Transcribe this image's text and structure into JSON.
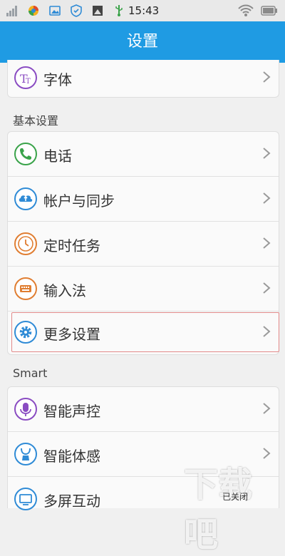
{
  "status_bar": {
    "time": "15:43",
    "left_icons": [
      "signal-icon",
      "app-icon",
      "image-icon",
      "shield-icon",
      "photo-icon",
      "usb-icon"
    ],
    "right_icons": [
      "wifi-icon",
      "battery-icon"
    ]
  },
  "header": {
    "title": "设置"
  },
  "items": {
    "font": "字体",
    "phone": "电话",
    "account_sync": "帐户与同步",
    "scheduled_tasks": "定时任务",
    "input_method": "输入法",
    "more_settings": "更多设置",
    "voice_control": "智能声控",
    "smart_motion": "智能体感",
    "multi_screen": "多屏互动"
  },
  "sections": {
    "basic": "基本设置",
    "smart": "Smart"
  },
  "watermark": {
    "logo_text": "下载吧",
    "sub_text": "已关闭"
  },
  "colors": {
    "header": "#1f9be3",
    "icon_green": "#3aa34a",
    "icon_blue": "#2f8bd6",
    "icon_orange": "#e07e32",
    "icon_purple": "#8a4cc2",
    "highlight_border": "#e28a8a"
  }
}
